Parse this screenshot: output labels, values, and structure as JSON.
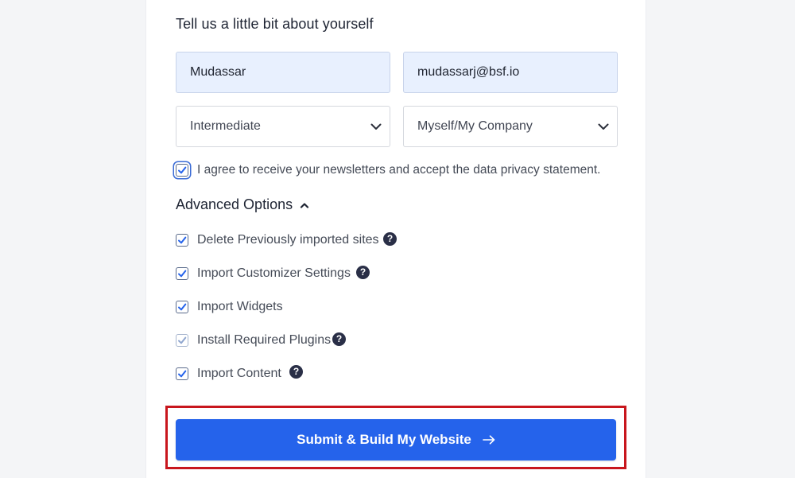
{
  "form": {
    "heading": "Tell us a little bit about yourself",
    "name_value": "Mudassar",
    "email_value": "mudassarj@bsf.io",
    "experience_selected": "Intermediate",
    "usage_selected": "Myself/My Company",
    "newsletter_consent": {
      "label": "I agree to receive your newsletters and accept the data privacy statement.",
      "checked": true
    }
  },
  "advanced": {
    "title": "Advanced Options",
    "expanded": true,
    "options": [
      {
        "label": "Delete Previously imported sites",
        "checked": true,
        "help": true
      },
      {
        "label": "Import Customizer Settings",
        "checked": true,
        "help": true
      },
      {
        "label": "Import Widgets",
        "checked": true,
        "help": false
      },
      {
        "label": "Install Required Plugins",
        "checked": true,
        "disabled": true,
        "help": true
      },
      {
        "label": "Import Content",
        "checked": true,
        "help": true
      }
    ],
    "help_glyph": "?"
  },
  "submit": {
    "label": "Submit & Build My Website",
    "icon": "arrow-right-icon"
  },
  "colors": {
    "accent": "#2563eb",
    "highlight_border": "#c8161d",
    "filled_input_bg": "#e8f0fe",
    "help_icon_bg": "#2a2f47"
  }
}
